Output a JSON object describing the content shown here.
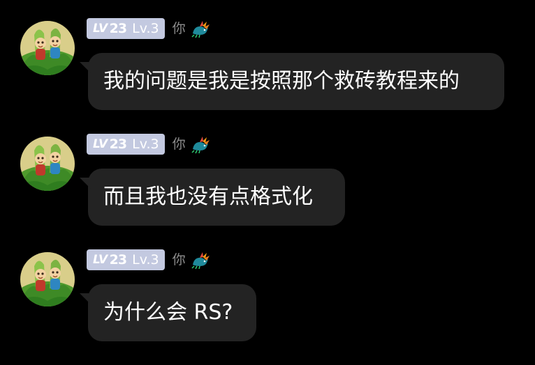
{
  "messages": [
    {
      "sender": {
        "level_mark": "LV",
        "level_number": "23",
        "level_text": "Lv.3",
        "name": "你",
        "badge_icon": "dragon-icon",
        "avatar": "cartoon-avatar"
      },
      "text": "我的问题是我是按照那个救砖教程来的"
    },
    {
      "sender": {
        "level_mark": "LV",
        "level_number": "23",
        "level_text": "Lv.3",
        "name": "你",
        "badge_icon": "dragon-icon",
        "avatar": "cartoon-avatar"
      },
      "text": "而且我也没有点格式化"
    },
    {
      "sender": {
        "level_mark": "LV",
        "level_number": "23",
        "level_text": "Lv.3",
        "name": "你",
        "badge_icon": "dragon-icon",
        "avatar": "cartoon-avatar"
      },
      "text": "为什么会 RS?"
    }
  ],
  "colors": {
    "background": "#000000",
    "bubble": "#232323",
    "level_badge": "#c3c9e0",
    "name_text": "#8d8d8d",
    "message_text": "#ffffff"
  }
}
